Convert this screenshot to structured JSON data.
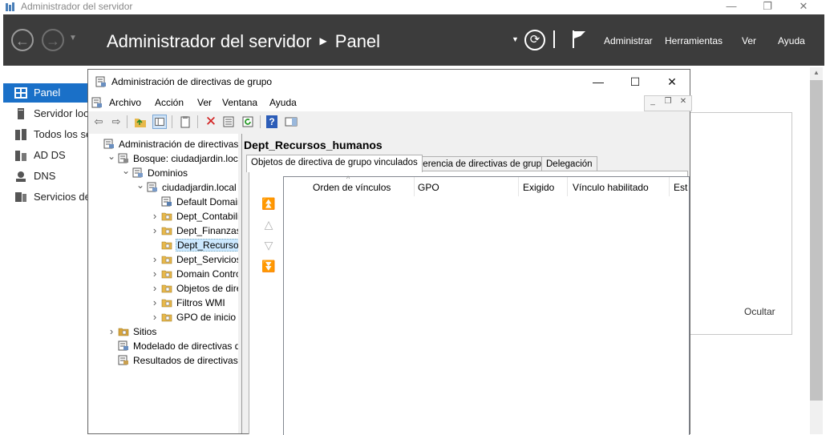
{
  "server_manager": {
    "window_title": "Administrador del servidor",
    "breadcrumb_app": "Administrador del servidor",
    "breadcrumb_page": "Panel",
    "header_menu": [
      "Administrar",
      "Herramientas",
      "Ver",
      "Ayuda"
    ],
    "sidebar": [
      {
        "label": "Panel",
        "icon": "dashboard-icon",
        "active": true
      },
      {
        "label": "Servidor local",
        "icon": "server-icon",
        "active": false
      },
      {
        "label": "Todos los servidores",
        "icon": "servers-icon",
        "active": false
      },
      {
        "label": "AD DS",
        "icon": "ad-ds-icon",
        "active": false
      },
      {
        "label": "DNS",
        "icon": "dns-icon",
        "active": false
      },
      {
        "label": "Servicios de archivos y de almacenamiento",
        "icon": "file-services-icon",
        "active": false
      }
    ],
    "hide_label": "Ocultar",
    "accent_color": "#1a70c8",
    "header_color": "#3c3c3c"
  },
  "gpmc": {
    "window_title": "Administración de directivas de grupo",
    "menu": [
      "Archivo",
      "Acción",
      "Ver",
      "Ventana",
      "Ayuda"
    ],
    "tree": [
      {
        "label": "Administración de directivas de grupo",
        "level": 0,
        "expander": "",
        "icon": "gpmc-icon"
      },
      {
        "label": "Bosque: ciudadjardin.local",
        "level": 1,
        "expander": "expanded",
        "icon": "forest-icon"
      },
      {
        "label": "Dominios",
        "level": 2,
        "expander": "expanded",
        "icon": "domains-icon"
      },
      {
        "label": "ciudadjardin.local",
        "level": 3,
        "expander": "expanded",
        "icon": "domain-icon"
      },
      {
        "label": "Default Domain Policy",
        "level": 4,
        "expander": "",
        "icon": "gpo-link-icon"
      },
      {
        "label": "Dept_Contabilidad",
        "level": 4,
        "expander": "collapsed",
        "icon": "ou-icon"
      },
      {
        "label": "Dept_Finanzas",
        "level": 4,
        "expander": "collapsed",
        "icon": "ou-icon"
      },
      {
        "label": "Dept_Recursos_humanos",
        "level": 4,
        "expander": "",
        "icon": "ou-icon",
        "selected": true
      },
      {
        "label": "Dept_Servicios_generales",
        "level": 4,
        "expander": "collapsed",
        "icon": "ou-icon"
      },
      {
        "label": "Domain Controllers",
        "level": 4,
        "expander": "collapsed",
        "icon": "ou-icon"
      },
      {
        "label": "Objetos de directiva de grupo",
        "level": 4,
        "expander": "collapsed",
        "icon": "gpo-folder-icon"
      },
      {
        "label": "Filtros WMI",
        "level": 4,
        "expander": "collapsed",
        "icon": "wmi-folder-icon"
      },
      {
        "label": "GPO de inicio",
        "level": 4,
        "expander": "collapsed",
        "icon": "starter-gpo-icon"
      },
      {
        "label": "Sitios",
        "level": 1,
        "expander": "collapsed",
        "icon": "sites-icon"
      },
      {
        "label": "Modelado de directivas de grupo",
        "level": 1,
        "expander": "",
        "icon": "modeling-icon"
      },
      {
        "label": "Resultados de directivas de grupo",
        "level": 1,
        "expander": "",
        "icon": "results-icon"
      }
    ],
    "detail_title": "Dept_Recursos_humanos",
    "tabs": [
      "Objetos de directiva de grupo vinculados",
      "Herencia de directivas de grupo",
      "Delegación"
    ],
    "active_tab": 0,
    "columns": [
      "Orden de vínculos",
      "GPO",
      "Exigido",
      "Vínculo habilitado",
      "Estado de GPO"
    ]
  }
}
